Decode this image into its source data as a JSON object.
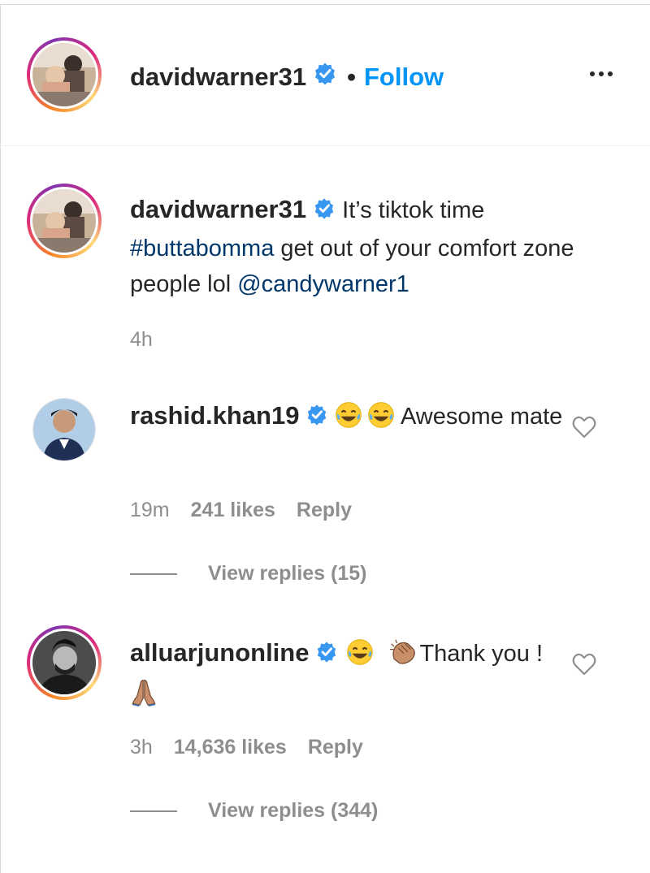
{
  "header": {
    "username": "davidwarner31",
    "separator": "•",
    "follow_label": "Follow"
  },
  "caption": {
    "username": "davidwarner31",
    "text_1": " It’s tiktok time ",
    "hashtag": "#buttabomma",
    "text_2": " get out of your comfort zone people lol ",
    "mention": "@candywarner1",
    "time": "4h"
  },
  "comments": [
    {
      "username": "rashid.khan19",
      "text": " Awesome mate",
      "time": "19m",
      "likes": "241 likes",
      "reply_label": "Reply",
      "view_replies": "View replies (15)",
      "emojis": [
        "laughing-tears",
        "laughing-tears"
      ]
    },
    {
      "username": "alluarjunonline",
      "text_1": "Thank you ! ",
      "time": "3h",
      "likes": "14,636 likes",
      "reply_label": "Reply",
      "view_replies": "View replies (344)",
      "emojis": [
        "laughing-tears",
        "clapping-hands",
        "folded-hands"
      ]
    }
  ],
  "colors": {
    "link_blue": "#0095f6",
    "verified_blue": "#3897f0",
    "hashtag_blue": "#00376b",
    "meta_gray": "#8e8e8e"
  },
  "icons": [
    "verified-badge-icon",
    "more-options-icon",
    "heart-icon"
  ]
}
